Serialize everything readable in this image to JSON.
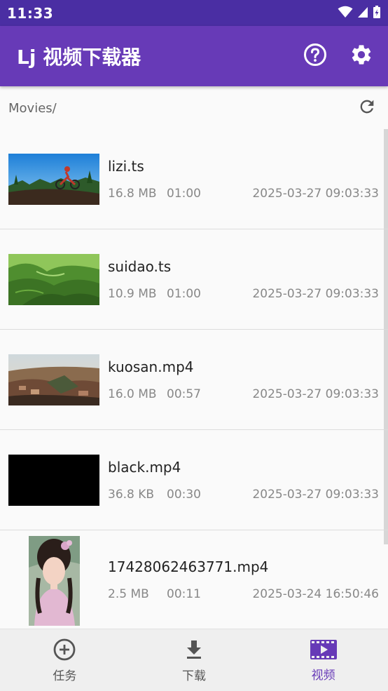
{
  "status_bar": {
    "time": "11:33"
  },
  "app_bar": {
    "title": "Lj 视频下载器"
  },
  "path": {
    "text": "Movies/"
  },
  "files": [
    {
      "name": "lizi.ts",
      "size": "16.8 MB",
      "duration": "01:00",
      "date": "2025-03-27 09:03:33"
    },
    {
      "name": "suidao.ts",
      "size": "10.9 MB",
      "duration": "01:00",
      "date": "2025-03-27 09:03:33"
    },
    {
      "name": "kuosan.mp4",
      "size": "16.0 MB",
      "duration": "00:57",
      "date": "2025-03-27 09:03:33"
    },
    {
      "name": "black.mp4",
      "size": "36.8 KB",
      "duration": "00:30",
      "date": "2025-03-27 09:03:33"
    },
    {
      "name": "17428062463771.mp4",
      "size": "2.5 MB",
      "duration": "00:11",
      "date": "2025-03-24 16:50:46"
    }
  ],
  "bottom_nav": {
    "tasks": "任务",
    "download": "下载",
    "videos": "视频"
  },
  "colors": {
    "primary": "#673ab7",
    "status": "#4a2ea3",
    "accent_active": "#673ab7"
  }
}
